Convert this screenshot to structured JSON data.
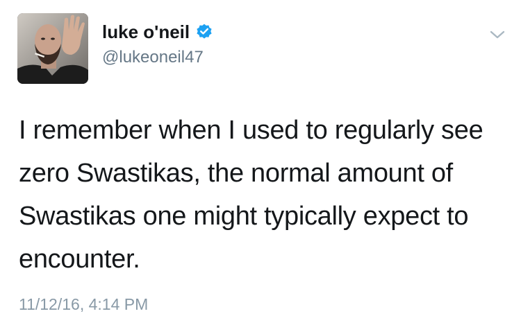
{
  "user": {
    "display_name": "luke o'neil",
    "handle": "@lukeoneil47",
    "verified": true,
    "avatar_icon": "profile-photo"
  },
  "tweet": {
    "text": "I remember when I used to regularly see zero Swastikas, the normal amount of Swastikas one might typically expect to encounter.",
    "timestamp": "11/12/16, 4:14 PM"
  },
  "icons": {
    "verified": "verified-badge-icon",
    "menu": "chevron-down-icon"
  },
  "colors": {
    "text": "#14171a",
    "secondary": "#657786",
    "timestamp": "#8899a6",
    "verified_blue": "#1da1f2",
    "chevron": "#aab8c2"
  }
}
